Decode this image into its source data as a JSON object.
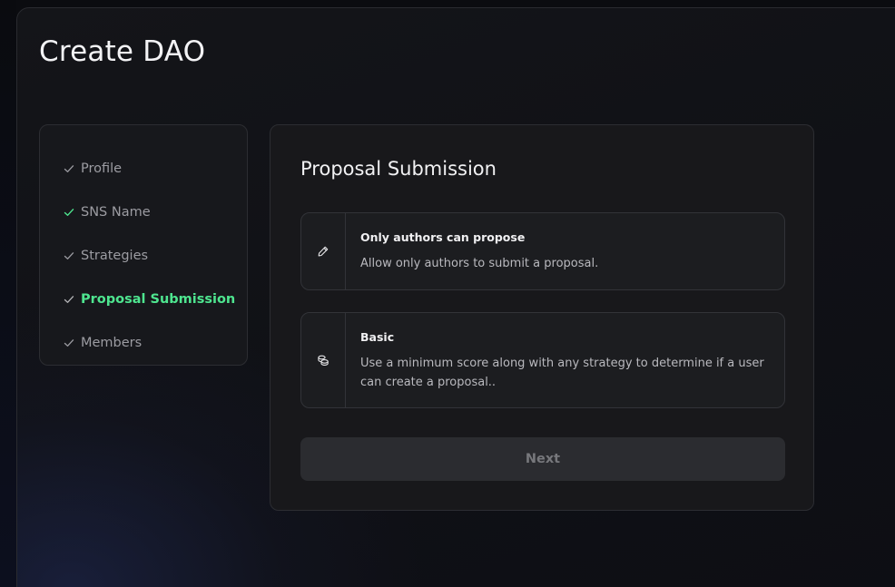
{
  "page": {
    "title": "Create DAO"
  },
  "steps": [
    {
      "label": "Profile",
      "state": "done"
    },
    {
      "label": "SNS Name",
      "state": "done-green"
    },
    {
      "label": "Strategies",
      "state": "done"
    },
    {
      "label": "Proposal Submission",
      "state": "active"
    },
    {
      "label": "Members",
      "state": "done"
    }
  ],
  "panel": {
    "title": "Proposal Submission",
    "options": [
      {
        "title": "Only authors can propose",
        "description": "Allow only authors to submit a proposal.",
        "icon": "pencil-icon"
      },
      {
        "title": "Basic",
        "description": "Use a minimum score along with any strategy to determine if a user can create a proposal..",
        "icon": "coins-icon"
      }
    ],
    "next_label": "Next"
  },
  "colors": {
    "accent": "#4ee58f",
    "background": "#0b0c10",
    "card": "#18181b",
    "button_disabled": "#2b2c30"
  }
}
